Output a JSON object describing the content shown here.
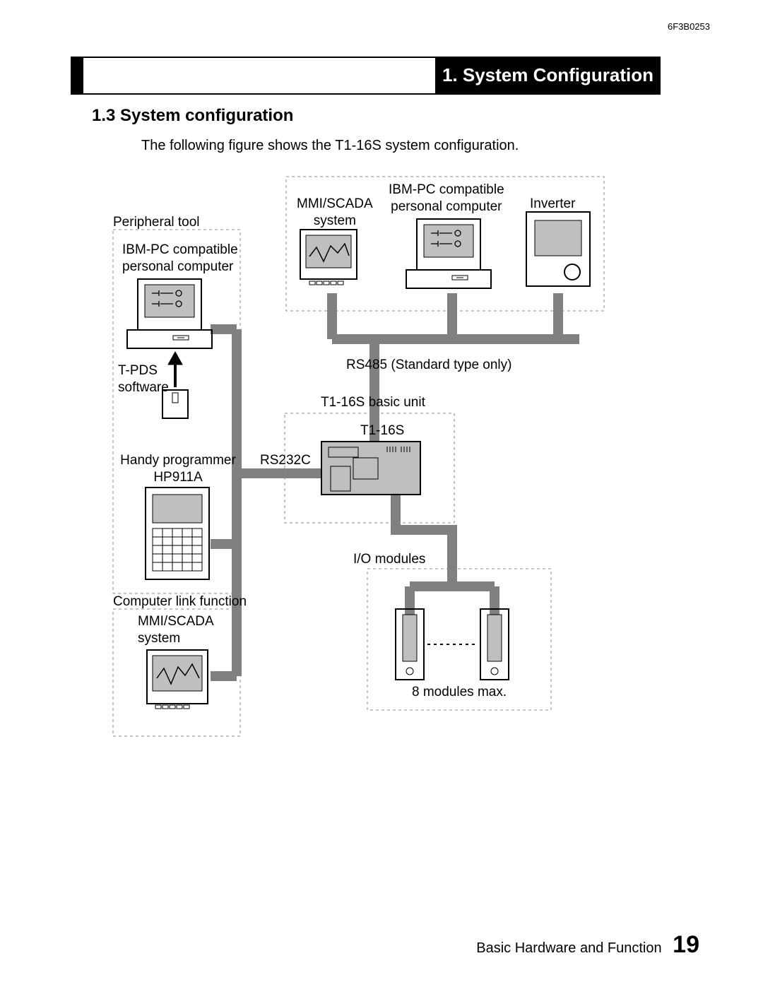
{
  "doc_id": "6F3B0253",
  "chapter_title": "1. System Configuration",
  "section_title": "1.3  System configuration",
  "intro": "The following figure shows the T1-16S system configuration.",
  "labels": {
    "peripheral_tool": "Peripheral tool",
    "ibm_pc": "IBM-PC compatible\npersonal computer",
    "tpds": "T-PDS\nsoftware",
    "handy_prog": "Handy programmer\nHP911A",
    "comp_link": "Computer link function",
    "mmi_left": "MMI/SCADA\nsystem",
    "mmi_top": "MMI/SCADA\nsystem",
    "ibm_pc_top": "IBM-PC compatible\npersonal computer",
    "inverter": "Inverter",
    "rs485": "RS485 (Standard type only)",
    "basic_unit": "T1-16S basic unit",
    "t116s": "T1-16S",
    "rs232c": "RS232C",
    "io_modules": "I/O modules",
    "modules_max": "8 modules max."
  },
  "footer_text": "Basic Hardware and Function",
  "page_number": "19"
}
